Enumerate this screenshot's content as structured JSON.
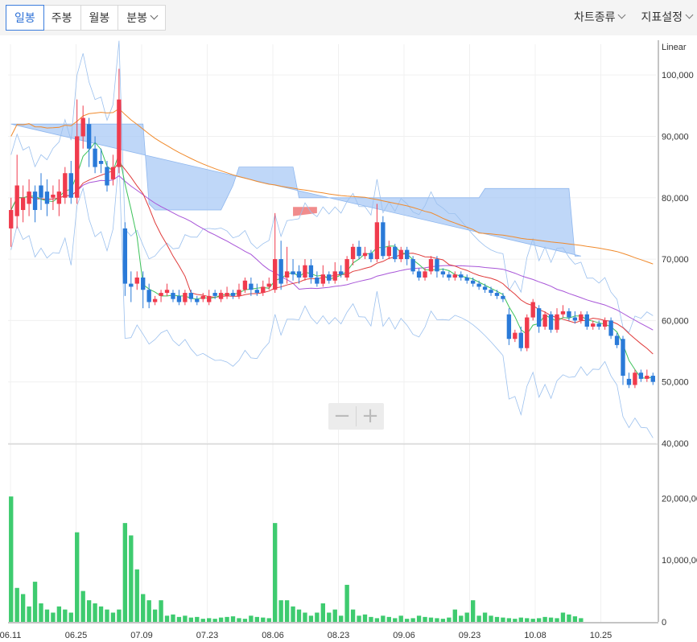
{
  "tabs": [
    {
      "label": "일봉",
      "active": true
    },
    {
      "label": "주봉",
      "active": false
    },
    {
      "label": "월봉",
      "active": false
    },
    {
      "label": "분봉",
      "active": false,
      "dropdown": true
    }
  ],
  "menus": [
    {
      "label": "차트종류"
    },
    {
      "label": "지표설정"
    }
  ],
  "zoom": {
    "minus_label": "−",
    "plus_label": "+"
  },
  "colors": {
    "up": "#f03b4d",
    "down": "#2a7ad8",
    "volume": "#3ecb6f",
    "ma5": "#3cc25a",
    "ma20": "#e03a3a",
    "ma60": "#a855d8",
    "ma120": "#f08a2c",
    "cloud": "#a9c9f5",
    "cloud_red": "#f08080",
    "band": "#9bc0ee"
  },
  "chart_data": {
    "type": "candlestick",
    "scale_label": "Linear",
    "price_axis": {
      "ticks": [
        "100,000",
        "90,000",
        "80,000",
        "70,000",
        "60,000",
        "50,000",
        "40,000"
      ],
      "min": 40000,
      "max": 105000
    },
    "volume_axis": {
      "ticks": [
        "20,000,00",
        "10,000,00",
        "0"
      ],
      "max": 28000000
    },
    "x_ticks": [
      "06.11",
      "06.25",
      "07.09",
      "07.23",
      "08.06",
      "08.23",
      "09.06",
      "09.23",
      "10.08",
      "10.25"
    ],
    "candles": [
      [
        75000,
        78000,
        72000,
        80000
      ],
      [
        77000,
        82000,
        75000,
        87000
      ],
      [
        78000,
        80000,
        76000,
        82000
      ],
      [
        79000,
        81000,
        77000,
        83000
      ],
      [
        81000,
        78000,
        76000,
        82000
      ],
      [
        82000,
        80000,
        78000,
        84000
      ],
      [
        81000,
        79000,
        77000,
        83000
      ],
      [
        80000,
        80500,
        78000,
        82000
      ],
      [
        79000,
        81000,
        77000,
        83000
      ],
      [
        80000,
        84000,
        79000,
        85000
      ],
      [
        84000,
        80000,
        79000,
        86000
      ],
      [
        80000,
        90000,
        79000,
        96000
      ],
      [
        90000,
        93000,
        88000,
        95000
      ],
      [
        92000,
        88000,
        85000,
        93000
      ],
      [
        88000,
        85000,
        84000,
        90000
      ],
      [
        86000,
        85500,
        84000,
        88000
      ],
      [
        85000,
        82000,
        81000,
        86000
      ],
      [
        83000,
        85000,
        82000,
        87000
      ],
      [
        85000,
        96000,
        84000,
        101000
      ],
      [
        75000,
        66000,
        64000,
        76000
      ],
      [
        66000,
        65500,
        63000,
        68000
      ],
      [
        66000,
        67000,
        65000,
        68000
      ],
      [
        67000,
        65000,
        62000,
        68000
      ],
      [
        65000,
        63000,
        62000,
        66000
      ],
      [
        63000,
        63500,
        62500,
        64000
      ],
      [
        64000,
        64500,
        63000,
        65000
      ],
      [
        64500,
        65000,
        64000,
        66000
      ],
      [
        64500,
        63500,
        63000,
        65000
      ],
      [
        64000,
        63000,
        62500,
        65000
      ],
      [
        63000,
        64500,
        62500,
        65000
      ],
      [
        64500,
        63500,
        63000,
        65000
      ],
      [
        63500,
        63000,
        62500,
        64000
      ],
      [
        63500,
        64000,
        63000,
        64500
      ],
      [
        63000,
        64000,
        62500,
        65000
      ],
      [
        64500,
        64000,
        63500,
        65000
      ],
      [
        63500,
        64500,
        63000,
        65000
      ],
      [
        64000,
        64500,
        63500,
        65500
      ],
      [
        64500,
        64000,
        63500,
        65000
      ],
      [
        64000,
        65000,
        63500,
        66000
      ],
      [
        65000,
        66500,
        64500,
        67000
      ],
      [
        66000,
        65000,
        64000,
        67000
      ],
      [
        65000,
        64500,
        64000,
        66000
      ],
      [
        64500,
        65500,
        64000,
        66500
      ],
      [
        65500,
        66000,
        65000,
        67000
      ],
      [
        65000,
        70000,
        64500,
        77500
      ],
      [
        70000,
        66000,
        65000,
        73000
      ],
      [
        67000,
        68000,
        66000,
        72000
      ],
      [
        68000,
        67500,
        66500,
        70000
      ],
      [
        68000,
        67000,
        66000,
        69000
      ],
      [
        67000,
        69000,
        66500,
        70000
      ],
      [
        69000,
        67000,
        66000,
        70000
      ],
      [
        67000,
        66000,
        65500,
        68000
      ],
      [
        66000,
        67500,
        65500,
        69000
      ],
      [
        67500,
        66500,
        66000,
        68000
      ],
      [
        66500,
        68000,
        66000,
        69500
      ],
      [
        68000,
        67500,
        67000,
        69000
      ],
      [
        67000,
        70000,
        66500,
        70500
      ],
      [
        70000,
        72000,
        69000,
        72500
      ],
      [
        72000,
        70500,
        70000,
        73000
      ],
      [
        70500,
        71000,
        70000,
        72000
      ],
      [
        71000,
        70000,
        69500,
        71500
      ],
      [
        70000,
        76000,
        69500,
        79000
      ],
      [
        76000,
        70500,
        70000,
        77000
      ],
      [
        70500,
        72000,
        70000,
        73000
      ],
      [
        72000,
        70000,
        69500,
        72500
      ],
      [
        70000,
        71500,
        69500,
        72000
      ],
      [
        71500,
        70000,
        69000,
        72000
      ],
      [
        70000,
        68000,
        67500,
        70500
      ],
      [
        68000,
        67000,
        66500,
        68500
      ],
      [
        67000,
        68000,
        66500,
        68500
      ],
      [
        68000,
        70000,
        67500,
        70500
      ],
      [
        70000,
        68000,
        67000,
        70500
      ],
      [
        68000,
        67500,
        67000,
        68500
      ],
      [
        67500,
        67000,
        66500,
        68000
      ],
      [
        67000,
        67500,
        66500,
        68000
      ],
      [
        67500,
        67000,
        66500,
        68000
      ],
      [
        67000,
        66500,
        66000,
        67500
      ],
      [
        66500,
        66000,
        65500,
        67000
      ],
      [
        66000,
        65500,
        65000,
        66500
      ],
      [
        65500,
        65000,
        64500,
        66000
      ],
      [
        65000,
        64500,
        64000,
        65500
      ],
      [
        64500,
        64000,
        63500,
        65000
      ],
      [
        64000,
        63500,
        63000,
        64500
      ],
      [
        61000,
        57000,
        56000,
        62000
      ],
      [
        57000,
        58000,
        56500,
        58500
      ],
      [
        58000,
        55500,
        55000,
        59000
      ],
      [
        55500,
        60500,
        55000,
        61000
      ],
      [
        60500,
        63000,
        60000,
        63500
      ],
      [
        62000,
        59000,
        58000,
        62500
      ],
      [
        59000,
        61000,
        58500,
        61500
      ],
      [
        61000,
        58500,
        58000,
        61500
      ],
      [
        58500,
        61000,
        58000,
        62000
      ],
      [
        61000,
        61500,
        60500,
        62500
      ],
      [
        61500,
        60500,
        60000,
        62000
      ],
      [
        60500,
        60000,
        59500,
        61500
      ],
      [
        60000,
        61000,
        59500,
        61500
      ],
      [
        61000,
        59000,
        58500,
        61500
      ],
      [
        59000,
        59500,
        58500,
        60000
      ],
      [
        59500,
        59000,
        58500,
        60000
      ],
      [
        59000,
        60000,
        58500,
        60500
      ],
      [
        60000,
        57500,
        57000,
        60500
      ],
      [
        57500,
        56000,
        55500,
        58000
      ],
      [
        57000,
        51000,
        49500,
        57500
      ],
      [
        50500,
        49500,
        49000,
        51500
      ],
      [
        49500,
        51500,
        49000,
        52000
      ],
      [
        51500,
        50500,
        50000,
        52000
      ],
      [
        50500,
        51000,
        50000,
        52000
      ],
      [
        51000,
        50000,
        49500,
        51500
      ]
    ],
    "volumes": [
      20.3,
      5.5,
      4.5,
      2.5,
      6.5,
      3,
      2,
      1.5,
      2.5,
      2,
      1.5,
      14.5,
      5,
      3.5,
      3,
      2.5,
      2,
      1.5,
      2,
      16,
      14,
      8.5,
      4.5,
      3.5,
      2,
      3.5,
      1,
      1.2,
      0.8,
      1,
      0.7,
      0.8,
      0.5,
      0.6,
      0.5,
      0.7,
      0.8,
      0.9,
      0.6,
      0.5,
      1,
      0.8,
      0.7,
      0.6,
      16,
      3.5,
      3.5,
      2.5,
      2,
      1.5,
      1,
      1.5,
      3,
      1.5,
      2,
      1,
      6,
      2,
      1,
      1.2,
      0.8,
      0.6,
      1,
      0.8,
      0.6,
      1,
      0.5,
      0.6,
      1,
      0.8,
      0.7,
      0.6,
      0.5,
      0.7,
      2,
      1,
      1.5,
      3.5,
      1,
      1.5,
      1,
      0.8,
      0.7,
      0.6,
      0.5,
      0.7,
      0.6,
      0.5,
      0.6,
      0.8,
      0.7,
      0.6,
      1.5,
      1.2,
      0.9,
      0.6
    ]
  }
}
